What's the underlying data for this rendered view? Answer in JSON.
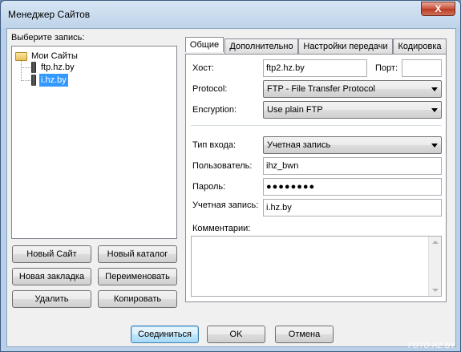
{
  "window": {
    "title": "Менеджер Сайтов",
    "close_symbol": "X"
  },
  "tree": {
    "heading": "Выберите запись:",
    "root": {
      "label": "Мои Сайты",
      "icon": "folder-icon"
    },
    "items": [
      {
        "label": "ftp.hz.by",
        "icon": "server-icon",
        "selected": false
      },
      {
        "label": "i.hz.by",
        "icon": "server-icon",
        "selected": true
      }
    ]
  },
  "left_buttons": {
    "new_site": "Новый Сайт",
    "new_folder": "Новый каталог",
    "new_bookmark": "Новая закладка",
    "rename": "Переименовать",
    "delete": "Удалить",
    "copy": "Копировать"
  },
  "tabs": [
    {
      "label": "Общие",
      "active": true
    },
    {
      "label": "Дополнительно",
      "active": false
    },
    {
      "label": "Настройки передачи",
      "active": false
    },
    {
      "label": "Кодировка",
      "active": false
    }
  ],
  "general": {
    "host_label": "Хост:",
    "host_value": "ftp2.hz.by",
    "port_label": "Порт:",
    "port_value": "",
    "protocol_label": "Protocol:",
    "protocol_value": "FTP - File Transfer Protocol",
    "encryption_label": "Encryption:",
    "encryption_value": "Use plain FTP",
    "logon_label": "Тип входа:",
    "logon_value": "Учетная запись",
    "user_label": "Пользователь:",
    "user_value": "ihz_bwn",
    "password_label": "Пароль:",
    "password_value": "●●●●●●●●",
    "account_label": "Учетная запись:",
    "account_value": "i.hz.by",
    "comments_label": "Комментарии:",
    "comments_value": ""
  },
  "bottom_buttons": {
    "connect": "Соединиться",
    "ok": "OK",
    "cancel": "Отмена"
  },
  "watermark": "FOTO.HZ.BY"
}
